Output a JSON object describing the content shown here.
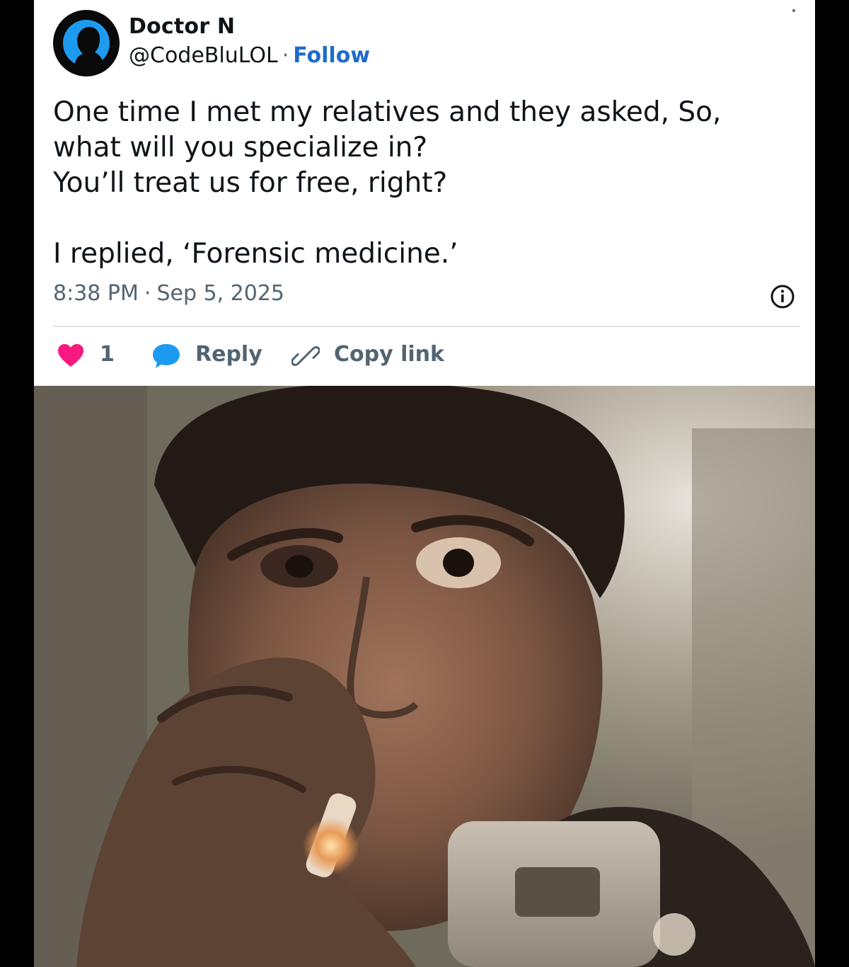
{
  "author": {
    "name": "Doctor N",
    "handle": "@CodeBluLOL",
    "separator": "·",
    "follow_label": "Follow"
  },
  "tweet": {
    "lines": [
      "One time I met my relatives and they asked, So,",
      "what will you specialize in?",
      "You’ll treat us for free, right?",
      "I replied, ‘Forensic medicine.’"
    ],
    "time": "8:38 PM",
    "separator": "·",
    "date": "Sep 5, 2025"
  },
  "actions": {
    "like_count": "1",
    "reply_label": "Reply",
    "copy_label": "Copy link"
  },
  "icons": {
    "avatar": "person-silhouette-icon",
    "info": "info-icon",
    "like": "heart-icon",
    "reply": "speech-bubble-icon",
    "copy": "link-icon"
  },
  "colors": {
    "follow": "#1d6ccf",
    "heart": "#f91880",
    "reply_bubble": "#1d9bf0",
    "avatar_figure": "#1d9bf0",
    "muted_text": "#536471"
  }
}
